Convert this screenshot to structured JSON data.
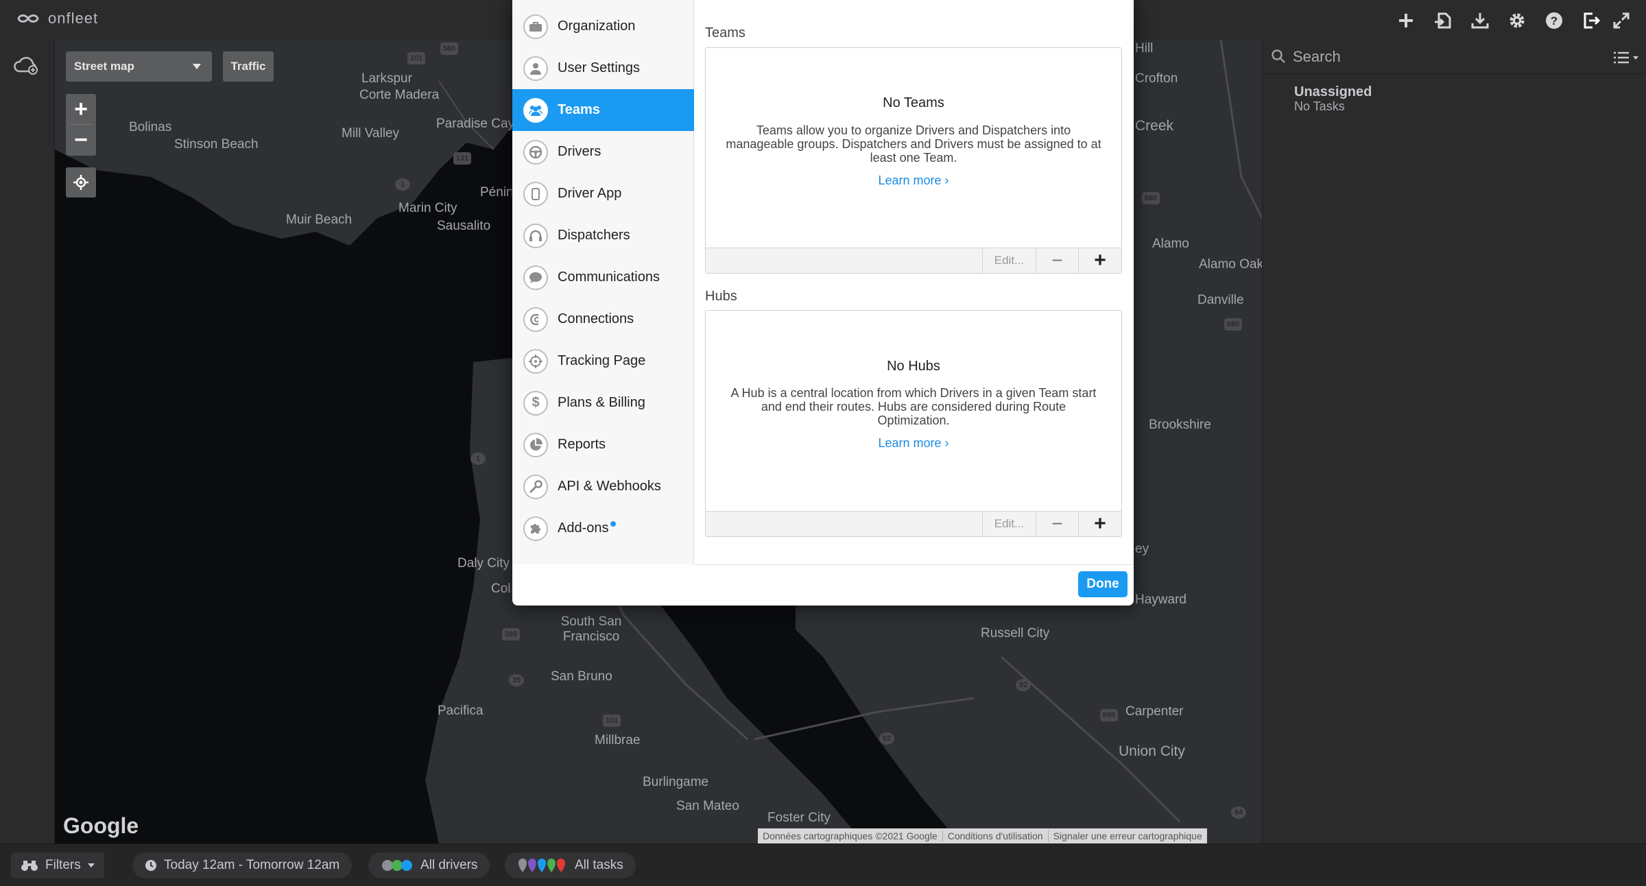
{
  "app": {
    "logo_text": "onfleet"
  },
  "topbar_icons": [
    "plus-icon",
    "import-icon",
    "download-icon",
    "gear-icon",
    "help-icon",
    "logout-icon",
    "expand-icon"
  ],
  "map": {
    "type_select": "Street map",
    "traffic_button": "Traffic",
    "zoom_in": "+",
    "zoom_out": "−",
    "attribution": "Données cartographiques ©2021 Google",
    "terms": "Conditions d'utilisation",
    "report": "Signaler une erreur cartographique",
    "google": "Google",
    "labels": [
      "Larkspur",
      "Corte Madera",
      "Bolinas",
      "Stinson Beach",
      "Mill Valley",
      "Paradise Cay",
      "Muir Beach",
      "Marin City",
      "Sausalito",
      "Péninsule de Tib",
      "Daly City",
      "Colma",
      "South San Francisco",
      "San Bruno",
      "Pacifica",
      "Millbrae",
      "Burlingame",
      "San Mateo",
      "Foster City",
      "Russell City",
      "Carpenter",
      "Union City",
      "Alamo",
      "Alamo Oaks",
      "Danville",
      "Brookshire",
      "Hill",
      "Crofton",
      "Creek",
      "Hayward",
      "ey"
    ],
    "road_shields": [
      "101",
      "580",
      "131",
      "1",
      "1",
      "280",
      "35",
      "101",
      "92",
      "92",
      "880",
      "84",
      "680",
      "680"
    ]
  },
  "right_panel": {
    "search_placeholder": "Search",
    "unassigned_title": "Unassigned",
    "unassigned_sub": "No Tasks"
  },
  "bottom_bar": {
    "filters": "Filters",
    "date_range": "Today 12am - Tomorrow 12am",
    "drivers": "All drivers",
    "tasks": "All tasks"
  },
  "modal": {
    "sidebar": [
      {
        "label": "Organization",
        "icon": "briefcase-icon"
      },
      {
        "label": "User Settings",
        "icon": "user-icon"
      },
      {
        "label": "Teams",
        "icon": "team-icon",
        "active": true
      },
      {
        "label": "Drivers",
        "icon": "steering-wheel-icon"
      },
      {
        "label": "Driver App",
        "icon": "phone-icon"
      },
      {
        "label": "Dispatchers",
        "icon": "headset-icon"
      },
      {
        "label": "Communications",
        "icon": "chat-icon"
      },
      {
        "label": "Connections",
        "icon": "connection-icon"
      },
      {
        "label": "Tracking Page",
        "icon": "crosshair-icon"
      },
      {
        "label": "Plans & Billing",
        "icon": "dollar-icon"
      },
      {
        "label": "Reports",
        "icon": "pie-chart-icon"
      },
      {
        "label": "API & Webhooks",
        "icon": "wrench-icon"
      },
      {
        "label": "Add-ons",
        "icon": "puzzle-icon"
      }
    ],
    "teams": {
      "section_title": "Teams",
      "empty_title": "No Teams",
      "description": "Teams allow you to organize Drivers and Dispatchers into manageable groups. Dispatchers and Drivers must be assigned to at least one Team.",
      "learn_more": "Learn more ›",
      "edit": "Edit...",
      "minus": "−",
      "plus": "+"
    },
    "hubs": {
      "section_title": "Hubs",
      "empty_title": "No Hubs",
      "description": "A Hub is a central location from which Drivers in a given Team start and end their routes. Hubs are considered during Route Optimization.",
      "learn_more": "Learn more ›",
      "edit": "Edit...",
      "minus": "−",
      "plus": "+"
    },
    "done": "Done"
  },
  "colors": {
    "accent": "#1b9af1",
    "link": "#1b8be0",
    "dark_bg": "#2b2b2c",
    "map_water": "#0b0c0e",
    "map_land": "#2e3033"
  }
}
